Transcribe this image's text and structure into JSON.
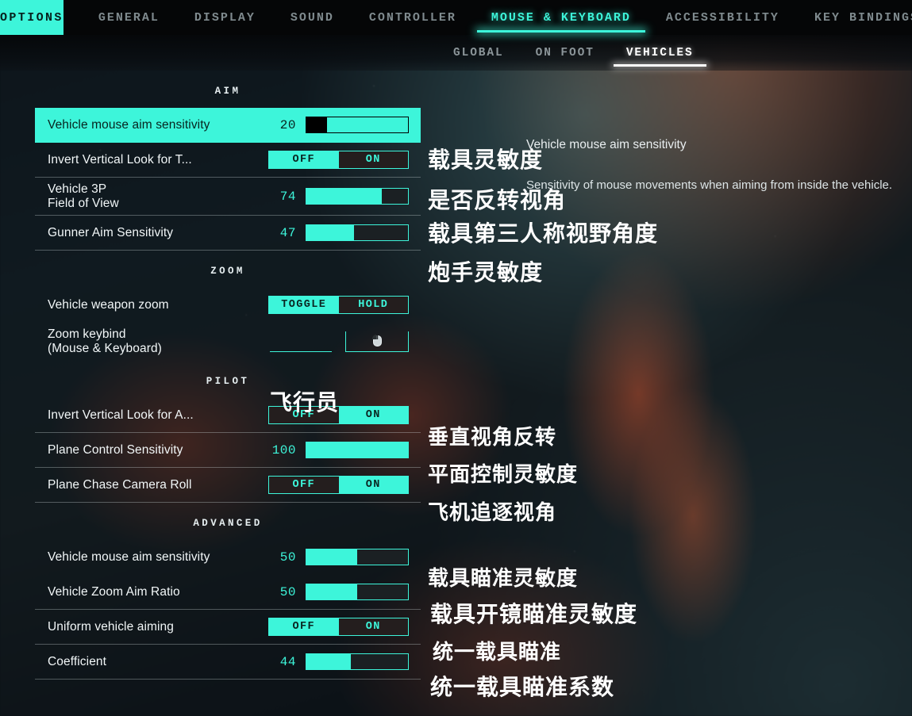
{
  "topbar": {
    "options_label": "OPTIONS",
    "tabs": [
      {
        "label": "GENERAL",
        "active": false
      },
      {
        "label": "DISPLAY",
        "active": false
      },
      {
        "label": "SOUND",
        "active": false
      },
      {
        "label": "CONTROLLER",
        "active": false
      },
      {
        "label": "MOUSE & KEYBOARD",
        "active": true
      },
      {
        "label": "ACCESSIBILITY",
        "active": false
      },
      {
        "label": "KEY BINDINGS",
        "active": false
      }
    ]
  },
  "subtabs": [
    {
      "label": "GLOBAL",
      "active": false
    },
    {
      "label": "ON FOOT",
      "active": false
    },
    {
      "label": "VEHICLES",
      "active": true
    }
  ],
  "sections": {
    "aim": "AIM",
    "zoom": "ZOOM",
    "pilot": "PILOT",
    "advanced": "ADVANCED"
  },
  "rows": {
    "vehicle_mouse_aim": {
      "label": "Vehicle mouse aim sensitivity",
      "value": "20",
      "fill": 20
    },
    "invert_vertical_turret": {
      "label": "Invert Vertical Look for T...",
      "off": "OFF",
      "on": "ON",
      "selected": "OFF"
    },
    "vehicle_3p_fov": {
      "label": "Vehicle 3P\nField of View",
      "value": "74",
      "fill": 74
    },
    "gunner_aim": {
      "label": "Gunner Aim Sensitivity",
      "value": "47",
      "fill": 47
    },
    "vehicle_weapon_zoom": {
      "label": "Vehicle weapon zoom",
      "off": "TOGGLE",
      "on": "HOLD",
      "selected": "TOGGLE"
    },
    "zoom_keybind": {
      "label": "Zoom keybind\n(Mouse & Keyboard)",
      "binding_icon": "mouse-icon"
    },
    "invert_vertical_aircraft": {
      "label": "Invert Vertical Look for A...",
      "off": "OFF",
      "on": "ON",
      "selected": "ON"
    },
    "plane_control": {
      "label": "Plane Control Sensitivity",
      "value": "100",
      "fill": 100
    },
    "plane_chase_roll": {
      "label": "Plane Chase Camera Roll",
      "off": "OFF",
      "on": "ON",
      "selected": "ON"
    },
    "adv_vehicle_mouse_aim": {
      "label": "Vehicle mouse aim sensitivity",
      "value": "50",
      "fill": 50
    },
    "vehicle_zoom_ratio": {
      "label": "Vehicle Zoom Aim Ratio",
      "value": "50",
      "fill": 50
    },
    "uniform_vehicle_aiming": {
      "label": "Uniform vehicle aiming",
      "off": "OFF",
      "on": "ON",
      "selected": "OFF"
    },
    "coefficient": {
      "label": "Coefficient",
      "value": "44",
      "fill": 44
    }
  },
  "tooltip": {
    "title": "Vehicle mouse aim sensitivity",
    "body": "Sensitivity of mouse movements when aiming from inside the vehicle."
  },
  "annotations": {
    "a1": "载具灵敏度",
    "a2": "是否反转视角",
    "a3": "载具第三人称视野角度",
    "a4": "炮手灵敏度",
    "a5": "飞行员",
    "a6": "垂直视角反转",
    "a7": "平面控制灵敏度",
    "a8": "飞机追逐视角",
    "a9": "载具瞄准灵敏度",
    "a10": "载具开镜瞄准灵敏度",
    "a11": "统一载具瞄准",
    "a12": "统一载具瞄准系数"
  },
  "colors": {
    "accent": "#3df5da",
    "accent_dark": "#07241f",
    "panel_line": "#dee8ea",
    "white": "#ffffff"
  }
}
